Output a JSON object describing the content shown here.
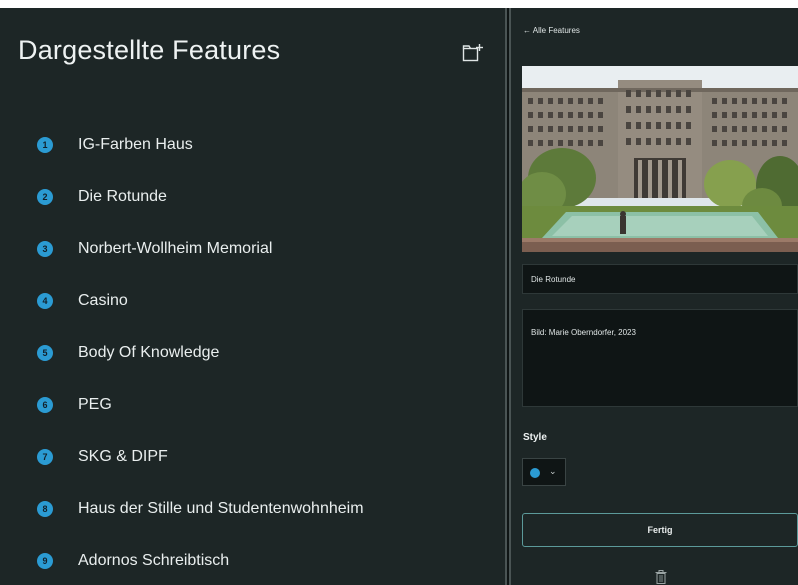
{
  "features_panel": {
    "title": "Dargestellte Features",
    "add_icon": "add-layer-icon",
    "items": [
      {
        "number": "1",
        "label": "IG-Farben Haus"
      },
      {
        "number": "2",
        "label": "Die Rotunde"
      },
      {
        "number": "3",
        "label": "Norbert-Wollheim Memorial"
      },
      {
        "number": "4",
        "label": "Casino"
      },
      {
        "number": "5",
        "label": "Body Of Knowledge"
      },
      {
        "number": "6",
        "label": "PEG"
      },
      {
        "number": "7",
        "label": "SKG & DIPF"
      },
      {
        "number": "8",
        "label": "Haus der Stille und Studentenwohnheim"
      },
      {
        "number": "9",
        "label": "Adornos Schreibtisch"
      }
    ]
  },
  "detail_panel": {
    "back_label": "← Alle Features",
    "title_value": "Die Rotunde",
    "description_value": "Bild: Marie Oberndorfer, 2023",
    "style_label": "Style",
    "style_chevron": "⌄",
    "done_label": "Fertig",
    "delete_icon": "trash-icon"
  },
  "colors": {
    "background": "#1d2626",
    "accent": "#2b9bd3",
    "button_border": "#5c9a9a"
  }
}
